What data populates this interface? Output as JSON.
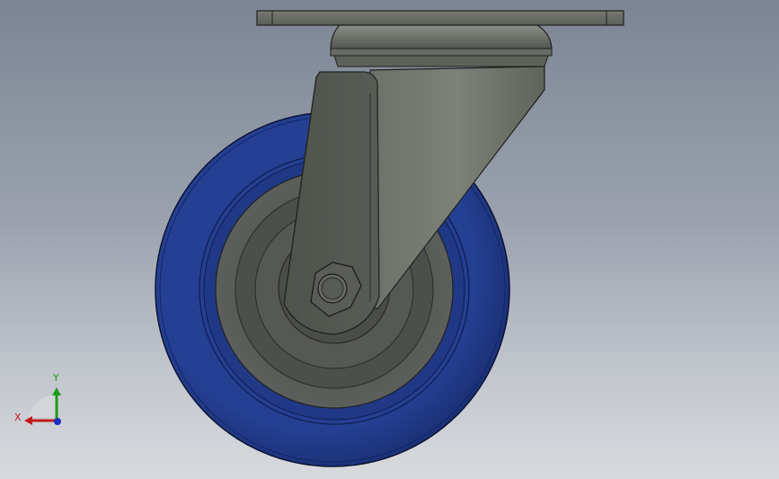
{
  "view": {
    "background_top": "#7d8595",
    "background_bottom": "#d8dadd"
  },
  "model": {
    "parts": [
      {
        "name": "top-plate",
        "color": "#5c6058"
      },
      {
        "name": "swivel-bearing",
        "color": "#5c6058"
      },
      {
        "name": "fork",
        "color": "#555950"
      },
      {
        "name": "wheel-tread",
        "color": "#1f3580"
      },
      {
        "name": "wheel-hub",
        "color": "#50534f"
      },
      {
        "name": "axle-nut",
        "color": "#585a54"
      }
    ]
  },
  "triad": {
    "y_label": "Y",
    "x_label": "X",
    "y_color": "#1a9b1a",
    "x_color": "#c21a1a",
    "z_color": "#1a2fc2"
  }
}
